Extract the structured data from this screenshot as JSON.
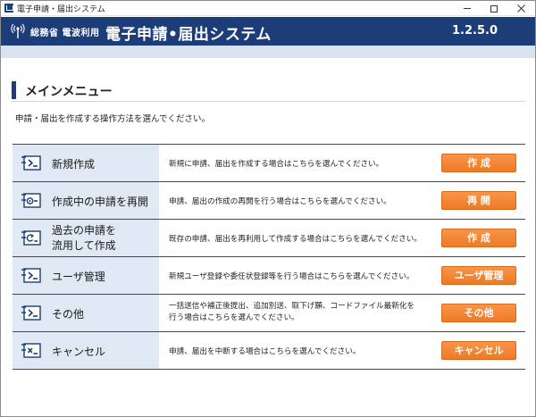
{
  "window": {
    "title": "電子申請・届出システム"
  },
  "header": {
    "ministry": "総務省 電波利用",
    "system_title": "電子申請•届出システム",
    "version": "1.2.5.0"
  },
  "main": {
    "section_title": "メインメニュー",
    "instruction": "申請・届出を作成する操作方法を選んでください。"
  },
  "menu_items": [
    {
      "title": "新規作成",
      "description": "新規に申請、届出を作成する場合はこちらを選んでください。",
      "button": "作 成",
      "icon": "new-document-icon"
    },
    {
      "title": "作成中の申請を再開",
      "description": "申請、届出の作成の再開を行う場合はこちらを選んでください。",
      "button": "再 開",
      "icon": "resume-document-icon"
    },
    {
      "title": "過去の申請を\n流用して作成",
      "description": "既存の申請、届出を再利用して作成する場合はこちらを選んでください。",
      "button": "作 成",
      "icon": "reuse-document-icon"
    },
    {
      "title": "ユーザ管理",
      "description": "新規ユーザ登録や委任状登録等を行う場合はこちらを選んでください。",
      "button": "ユーザ管理",
      "icon": "user-management-icon"
    },
    {
      "title": "その他",
      "description": "一括送信や補正後提出、追加別送、取下げ願、コードファイル最新化を\n行う場合はこちらを選んでください。",
      "button": "その他",
      "icon": "other-document-icon"
    },
    {
      "title": "キャンセル",
      "description": "申請、届出を中断する場合はこちらを選んでください。",
      "button": "キャンセル",
      "icon": "cancel-document-icon"
    }
  ],
  "colors": {
    "header_bg": "#1c3d78",
    "accent_button": "#ee7a26",
    "row_head_bg": "#dfe8f3"
  }
}
